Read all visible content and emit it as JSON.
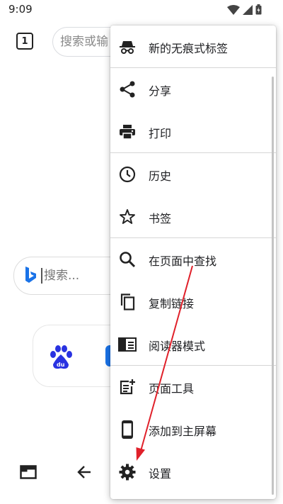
{
  "status_bar": {
    "time": "9:09",
    "icons": [
      "wifi-icon",
      "signal-icon",
      "battery-icon"
    ]
  },
  "toolbar": {
    "tab_count": "1",
    "omnibox_placeholder": "搜索或输"
  },
  "background": {
    "search_placeholder": "搜索...",
    "shortcuts": [
      "baidu-icon",
      "app-icon"
    ]
  },
  "bottom_bar": {
    "icons": [
      "tab-switcher-icon",
      "back-arrow-icon"
    ]
  },
  "menu": {
    "items": [
      {
        "label": "新的无痕式标签",
        "icon": "incognito-icon"
      },
      {
        "label": "分享",
        "icon": "share-icon"
      },
      {
        "label": "打印",
        "icon": "print-icon"
      },
      {
        "label": "历史",
        "icon": "history-icon"
      },
      {
        "label": "书签",
        "icon": "bookmark-star-icon"
      },
      {
        "label": "在页面中查找",
        "icon": "find-in-page-icon"
      },
      {
        "label": "复制链接",
        "icon": "copy-link-icon"
      },
      {
        "label": "阅读器模式",
        "icon": "reader-mode-icon"
      },
      {
        "label": "页面工具",
        "icon": "page-tools-icon"
      },
      {
        "label": "添加到主屏幕",
        "icon": "add-to-home-screen-icon"
      },
      {
        "label": "设置",
        "icon": "settings-gear-icon"
      }
    ]
  },
  "colors": {
    "annotation_arrow": "#e0202a",
    "bing_blue": "#1a73e8",
    "baidu_blue": "#2932e1"
  }
}
